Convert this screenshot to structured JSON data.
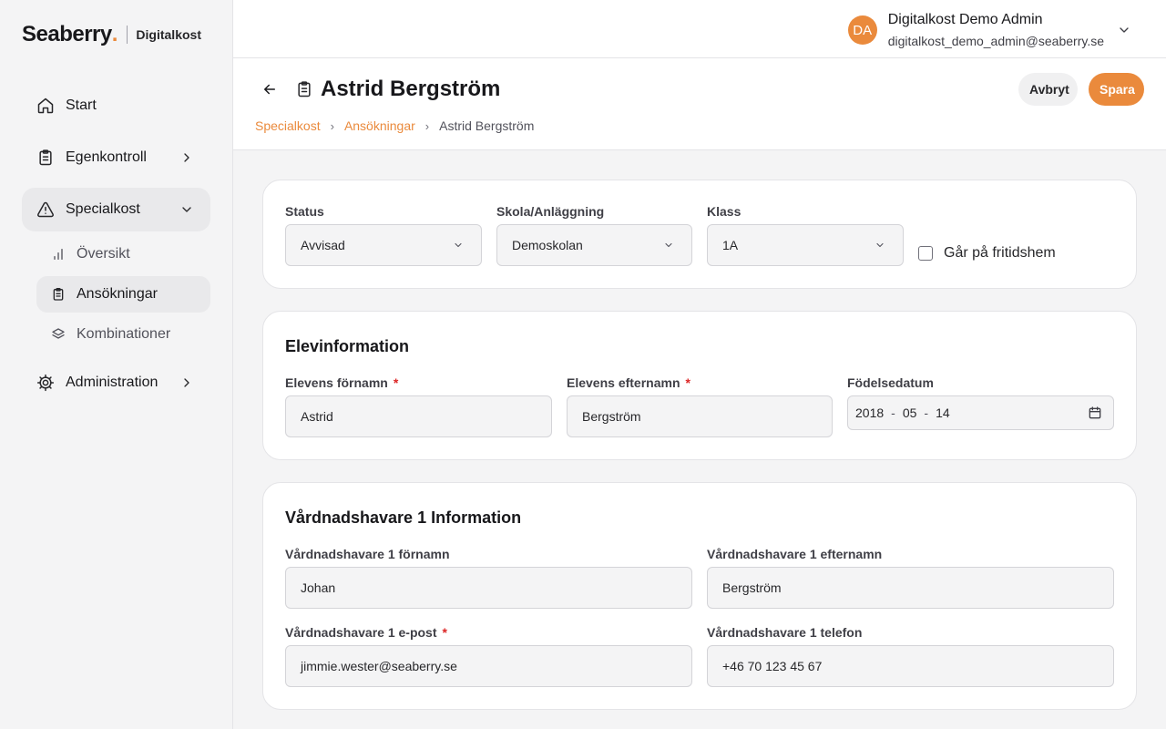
{
  "brand": {
    "name": "Seaberry",
    "dot": ".",
    "product": "Digitalkost"
  },
  "sidebar": {
    "items": [
      {
        "label": "Start",
        "icon": "home-icon"
      },
      {
        "label": "Egenkontroll",
        "icon": "clipboard-icon"
      },
      {
        "label": "Specialkost",
        "icon": "warning-icon",
        "sub": [
          {
            "label": "Översikt",
            "icon": "bar-chart-icon"
          },
          {
            "label": "Ansökningar",
            "icon": "clipboard-icon"
          },
          {
            "label": "Kombinationer",
            "icon": "layers-icon"
          }
        ]
      },
      {
        "label": "Administration",
        "icon": "gear-icon"
      }
    ]
  },
  "user": {
    "initials": "DA",
    "name": "Digitalkost Demo Admin",
    "email": "digitalkost_demo_admin@seaberry.se"
  },
  "header": {
    "title": "Astrid Bergström",
    "breadcrumbs": [
      "Specialkost",
      "Ansökningar",
      "Astrid Bergström"
    ],
    "cancel_label": "Avbryt",
    "save_label": "Spara"
  },
  "status_card": {
    "status": {
      "label": "Status",
      "value": "Avvisad"
    },
    "school": {
      "label": "Skola/Anläggning",
      "value": "Demoskolan"
    },
    "class": {
      "label": "Klass",
      "value": "1A"
    },
    "after_school": {
      "label": "Går på fritidshem",
      "checked": false
    }
  },
  "student": {
    "title": "Elevinformation",
    "first_name": {
      "label": "Elevens förnamn",
      "required": "*",
      "value": "Astrid"
    },
    "last_name": {
      "label": "Elevens efternamn",
      "required": "*",
      "value": "Bergström"
    },
    "birthdate": {
      "label": "Födelsedatum",
      "year": "2018",
      "month": "05",
      "day": "14",
      "sep": "-"
    }
  },
  "guardian1": {
    "title": "Vårdnadshavare 1 Information",
    "first_name": {
      "label": "Vårdnadshavare 1 förnamn",
      "value": "Johan"
    },
    "last_name": {
      "label": "Vårdnadshavare 1 efternamn",
      "value": "Bergström"
    },
    "email": {
      "label": "Vårdnadshavare 1 e-post",
      "required": "*",
      "value": "jimmie.wester@seaberry.se"
    },
    "phone": {
      "label": "Vårdnadshavare 1 telefon",
      "value": "+46 70 123 45 67"
    }
  },
  "colors": {
    "accent": "#ea8a3c",
    "required": "#dc2626"
  }
}
